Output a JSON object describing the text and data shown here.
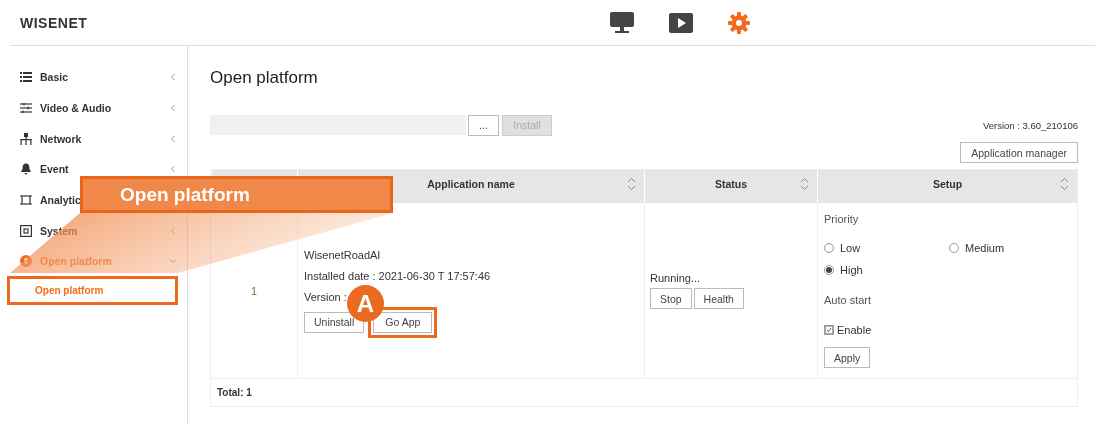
{
  "header": {
    "logo": "WISENET",
    "nav": [
      {
        "kind": "monitor",
        "selected": false
      },
      {
        "kind": "play",
        "selected": false
      },
      {
        "kind": "settings",
        "selected": true
      }
    ]
  },
  "sidebar": {
    "items": [
      {
        "kind": "list",
        "label": "Basic",
        "expanded": false
      },
      {
        "kind": "sliders",
        "label": "Video & Audio",
        "expanded": false
      },
      {
        "kind": "network",
        "label": "Network",
        "expanded": false
      },
      {
        "kind": "bell",
        "label": "Event",
        "expanded": false
      },
      {
        "kind": "frame",
        "label": "Analytic"
      },
      {
        "kind": "system",
        "label": "System",
        "expanded": false
      },
      {
        "kind": "platform",
        "label": "Open platform",
        "expanded": true,
        "children": [
          {
            "label": "Open platform",
            "selected": true,
            "highlighted": true
          }
        ]
      }
    ]
  },
  "page_title": "Open platform",
  "install": {
    "browse_button": "...",
    "install_button": "Install",
    "install_disabled": true
  },
  "version": "Version : 3.60_210106",
  "app_manager_button": "Application manager",
  "table": {
    "columns": [
      {
        "label": "Application name"
      },
      {
        "label": "Status"
      },
      {
        "label": "Setup"
      }
    ],
    "rows": [
      {
        "number": "1",
        "app_name": "WisenetRoadAI",
        "installed_date": "Installed date : 2021-06-30 T 17:57:46",
        "version": "Version :",
        "buttons": [
          {
            "label": "Uninstall",
            "highlighted": false
          },
          {
            "label": "Go App",
            "highlighted": true
          }
        ],
        "status": "Running...",
        "status_buttons": [
          "Stop",
          "Health"
        ],
        "priority_label": "Priority",
        "priority_options": [
          {
            "label": "Low",
            "selected": false
          },
          {
            "label": "Medium",
            "selected": false
          },
          {
            "label": "High",
            "selected": true
          }
        ],
        "auto_start_label": "Auto start",
        "auto_start": {
          "label": "Enable",
          "checked": true
        },
        "apply_button": "Apply"
      }
    ],
    "total": "Total: 1"
  },
  "annotations": {
    "callout": "Open platform",
    "badge": "A"
  }
}
